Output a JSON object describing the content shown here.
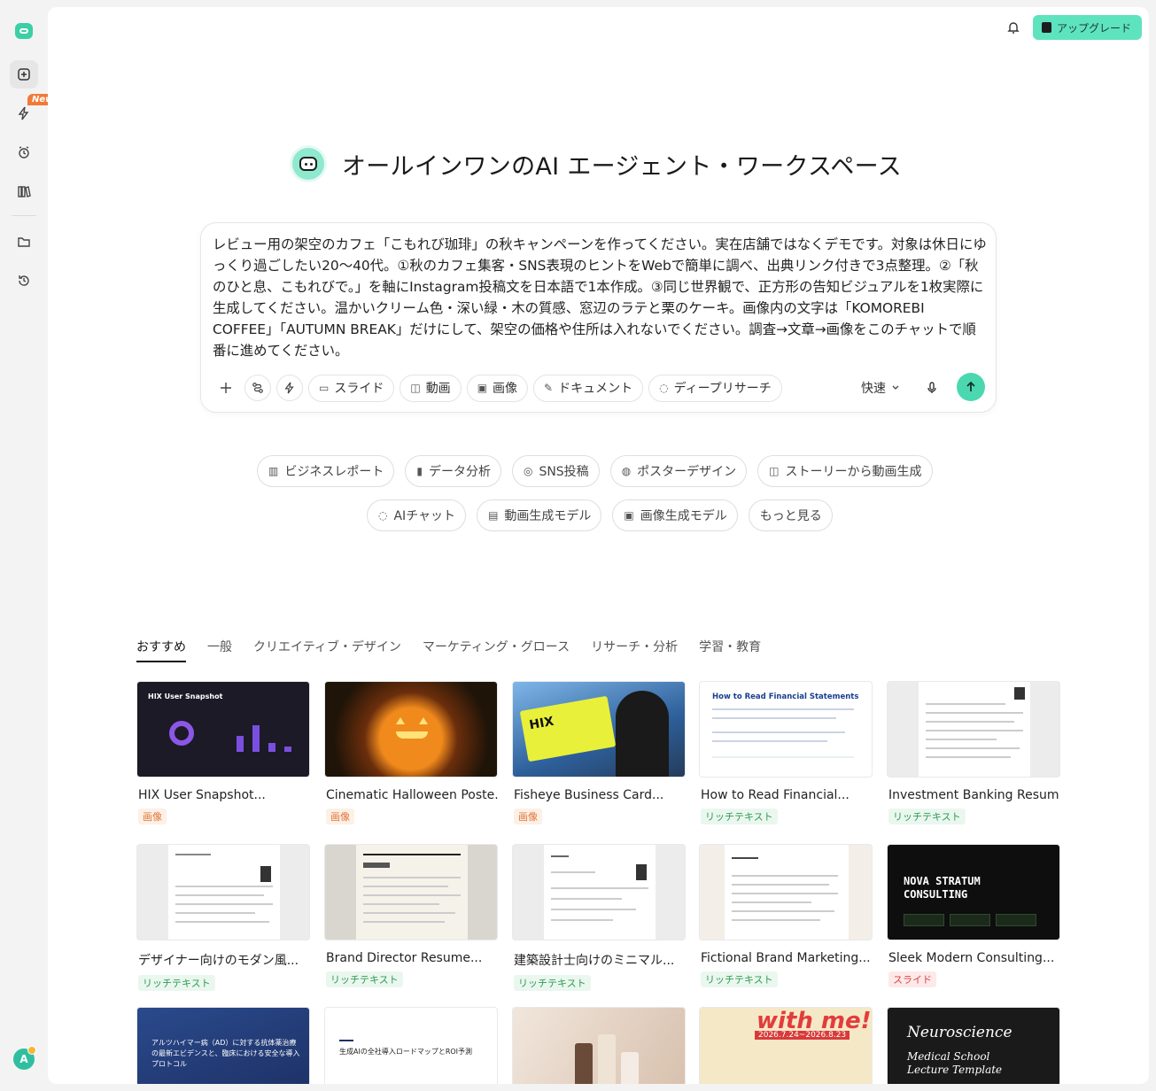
{
  "header": {
    "upgrade_label": "アップグレード"
  },
  "sidebar": {
    "new_badge": "New",
    "avatar_initial": "A"
  },
  "hero": {
    "title": "オールインワンのAI エージェント・ワークスペース"
  },
  "prompt": {
    "text": "レビュー用の架空のカフェ「こもれび珈琲」の秋キャンペーンを作ってください。実在店舗ではなくデモです。対象は休日にゆっくり過ごしたい20〜40代。①秋のカフェ集客・SNS表現のヒントをWebで簡単に調べ、出典リンク付きで3点整理。②「秋のひと息、こもれびで。」を軸にInstagram投稿文を日本語で1本作成。③同じ世界観で、正方形の告知ビジュアルを1枚実際に生成してください。温かいクリーム色・深い緑・木の質感、窓辺のラテと栗のケーキ。画像内の文字は「KOMOREBI COFFEE」「AUTUMN BREAK」だけにして、架空の価格や住所は入れないでください。調査→文章→画像をこのチャットで順番に進めてください。",
    "chips": [
      "スライド",
      "動画",
      "画像",
      "ドキュメント",
      "ディープリサーチ"
    ],
    "mode": "快速"
  },
  "suggestions": {
    "row1": [
      "ビジネスレポート",
      "データ分析",
      "SNS投稿",
      "ポスターデザイン",
      "ストーリーから動画生成"
    ],
    "row2": [
      "AIチャット",
      "動画生成モデル",
      "画像生成モデル",
      "もっと見る"
    ]
  },
  "tabs": [
    "おすすめ",
    "一般",
    "クリエイティブ・デザイン",
    "マーケティング・グロース",
    "リサーチ・分析",
    "学習・教育"
  ],
  "cards": [
    {
      "title": "HIX User Snapshot...",
      "tag": "画像",
      "thumb_text": "HIX User Snapshot"
    },
    {
      "title": "Cinematic Halloween Poste...",
      "tag": "画像"
    },
    {
      "title": "Fisheye Business Card...",
      "tag": "画像",
      "thumb_text": "HIX"
    },
    {
      "title": "How to Read Financial...",
      "tag": "リッチテキスト",
      "thumb_text": "How to Read Financial Statements"
    },
    {
      "title": "Investment Banking Resum...",
      "tag": "リッチテキスト"
    },
    {
      "title": "デザイナー向けのモダン風...",
      "tag": "リッチテキスト"
    },
    {
      "title": "Brand Director Resume...",
      "tag": "リッチテキスト"
    },
    {
      "title": "建築設計士向けのミニマル...",
      "tag": "リッチテキスト"
    },
    {
      "title": "Fictional Brand Marketing...",
      "tag": "リッチテキスト"
    },
    {
      "title": "Sleek Modern Consulting...",
      "tag": "スライド",
      "thumb_text": "NOVA STRATUM CONSULTING"
    },
    {
      "title": "",
      "tag": "",
      "thumb_text": "アルツハイマー病（AD）に対する抗体薬治療の最新エビデンスと、臨床における安全な導入プロトコル"
    },
    {
      "title": "",
      "tag": "",
      "thumb_text": "生成AIの全社導入ロードマップとROI予測"
    },
    {
      "title": "",
      "tag": ""
    },
    {
      "title": "",
      "tag": "",
      "thumb_text": "with me!",
      "thumb_date": "2026.7.24~2026.8.23"
    },
    {
      "title": "",
      "tag": "",
      "thumb_text": "Neuroscience",
      "thumb_sub1": "Medical School",
      "thumb_sub2": "Lecture Template"
    }
  ]
}
